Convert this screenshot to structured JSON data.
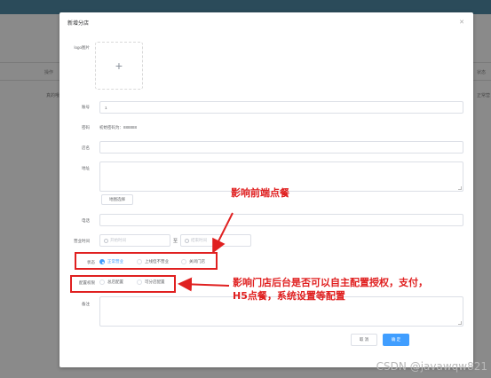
{
  "background": {
    "col_header_left": "操作",
    "col_header_right": "状态",
    "row_text_left": "真的哦",
    "row_text_right": "正常营"
  },
  "dialog": {
    "title": "新增分店",
    "close_icon": "close-icon",
    "logo_label": "logo图片",
    "account_label": "账号",
    "account_value": "1",
    "password_label": "密码",
    "password_hint": "初始密码为：888888",
    "store_name_label": "店名",
    "address_label": "地址",
    "map_select_button": "地图选择",
    "phone_label": "电话",
    "business_hours_label": "营业时间",
    "start_time_placeholder": "开始时间",
    "time_separator": "至",
    "end_time_placeholder": "结束时间",
    "status_label": "状态",
    "status_options": [
      "正常营业",
      "上线但不营业",
      "关闭门店"
    ],
    "status_selected": "正常营业",
    "config_label": "配置权限",
    "config_options": [
      "总店配置",
      "可分店配置"
    ],
    "remark_label": "备注",
    "cancel_button": "取 消",
    "confirm_button": "确 定"
  },
  "annotations": {
    "status_note": "影响前端点餐",
    "config_note": "影响门店后台是否可以自主配置授权，支付，H5点餐，系统设置等配置"
  },
  "watermark": "CSDN @javawqw821",
  "colors": {
    "primary": "#409eff",
    "annotation_red": "#e02020",
    "header_bar": "#2b4b5a"
  }
}
